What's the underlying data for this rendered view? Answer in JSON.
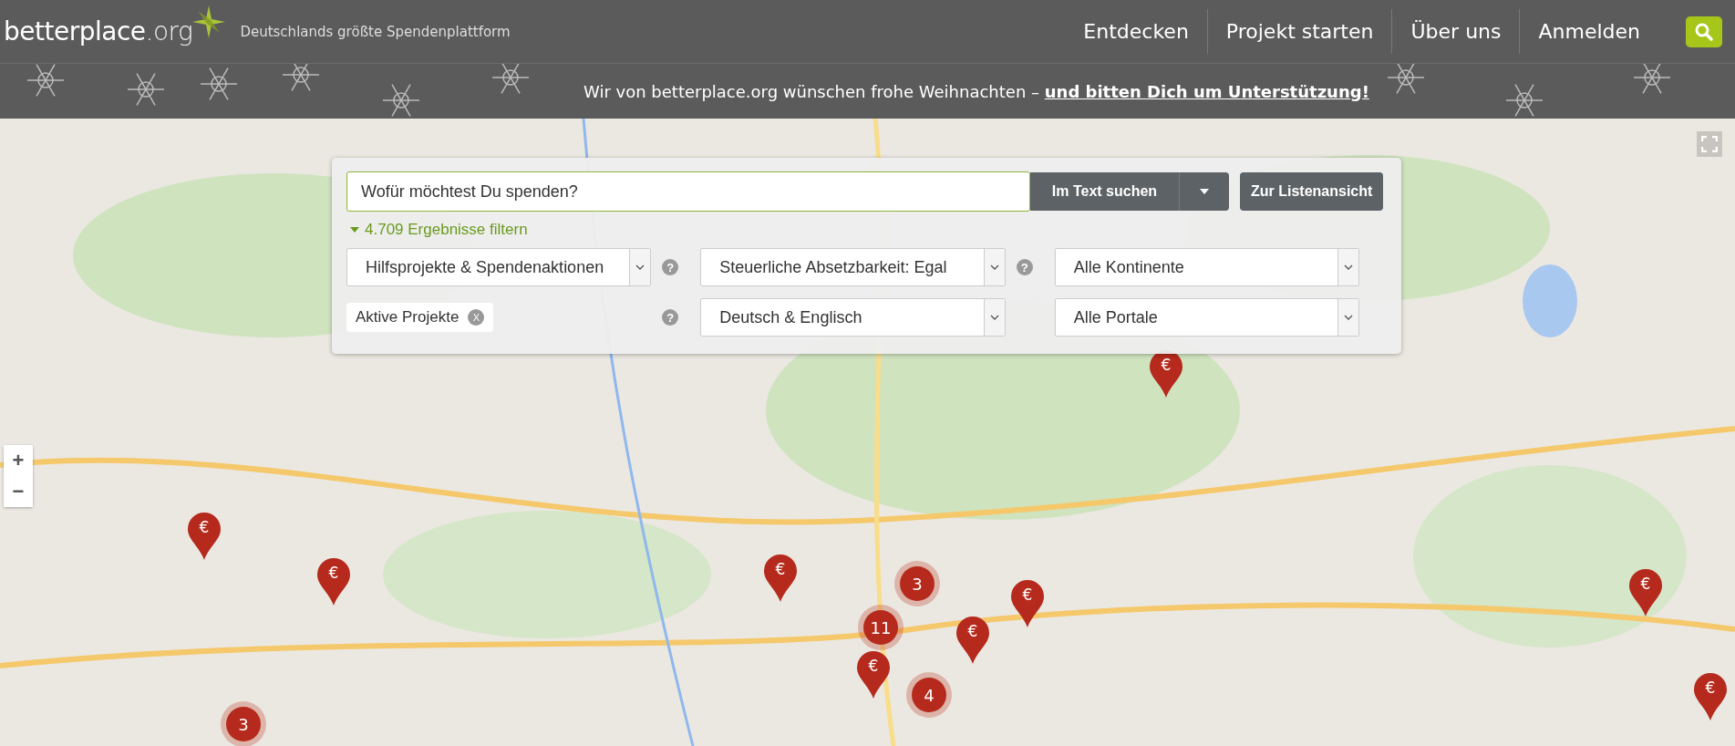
{
  "header": {
    "logo": {
      "name": "betterplace",
      "suffix": ".org"
    },
    "tagline": "Deutschlands größte Spendenplattform",
    "nav": [
      {
        "label": "Entdecken"
      },
      {
        "label": "Projekt starten"
      },
      {
        "label": "Über uns"
      },
      {
        "label": "Anmelden"
      }
    ]
  },
  "banner": {
    "text": "Wir von betterplace.org wünschen frohe Weihnachten –",
    "link": "und bitten Dich um Unterstützung!"
  },
  "search": {
    "placeholder": "Wofür möchtest Du spenden?",
    "search_button": "Im Text suchen",
    "list_button": "Zur Listenansicht",
    "filter_toggle": "4.709 Ergebnisse filtern",
    "expanded": true,
    "filters": [
      {
        "kind": "select",
        "value": "Hilfsprojekte & Spendenaktionen",
        "help": "?"
      },
      {
        "kind": "select",
        "value": "Steuerliche Absetzbarkeit: Egal",
        "help": "?"
      },
      {
        "kind": "select",
        "value": "Alle Kontinente"
      },
      {
        "kind": "tag",
        "value": "Aktive Projekte",
        "remove": "X",
        "help": "?"
      },
      {
        "kind": "select",
        "value": "Deutsch & Englisch"
      },
      {
        "kind": "select",
        "value": "Alle Portale"
      }
    ]
  },
  "map": {
    "zoom_in": "+",
    "zoom_out": "−",
    "markers": [
      {
        "kind": "pin",
        "label": "€"
      },
      {
        "kind": "pin",
        "label": "€"
      },
      {
        "kind": "pin",
        "label": "€"
      },
      {
        "kind": "pin",
        "label": "€"
      },
      {
        "kind": "pin",
        "label": "€"
      },
      {
        "kind": "pin",
        "label": "€"
      },
      {
        "kind": "pin",
        "label": "€"
      },
      {
        "kind": "pin",
        "label": "€"
      },
      {
        "kind": "pin",
        "label": "€"
      },
      {
        "kind": "cluster",
        "label": "3"
      },
      {
        "kind": "cluster",
        "label": "11"
      },
      {
        "kind": "cluster",
        "label": "4"
      },
      {
        "kind": "cluster",
        "label": "3"
      }
    ]
  }
}
